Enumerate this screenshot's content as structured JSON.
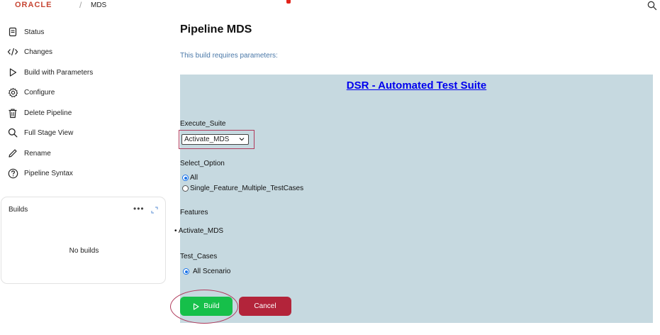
{
  "header": {
    "logo": "ORACLE",
    "separator": "/",
    "breadcrumb": "MDS"
  },
  "sidebar": {
    "items": [
      {
        "label": "Status",
        "icon": "document-icon"
      },
      {
        "label": "Changes",
        "icon": "code-icon"
      },
      {
        "label": "Build with Parameters",
        "icon": "play-icon"
      },
      {
        "label": "Configure",
        "icon": "gear-icon"
      },
      {
        "label": "Delete Pipeline",
        "icon": "trash-icon"
      },
      {
        "label": "Full Stage View",
        "icon": "search-icon"
      },
      {
        "label": "Rename",
        "icon": "pencil-icon"
      },
      {
        "label": "Pipeline Syntax",
        "icon": "help-icon"
      }
    ],
    "builds": {
      "title": "Builds",
      "more": "•••",
      "empty": "No builds"
    }
  },
  "main": {
    "title": "Pipeline MDS",
    "subtitle": "This build requires parameters:",
    "suite_title": "DSR - Automated Test Suite",
    "execute_suite": {
      "label": "Execute_Suite",
      "value": "Activate_MDS"
    },
    "select_option": {
      "label": "Select_Option",
      "options": [
        {
          "label": "All",
          "checked": true
        },
        {
          "label": "Single_Feature_Multiple_TestCases",
          "checked": false
        }
      ]
    },
    "features": {
      "label": "Features",
      "items": [
        "Activate_MDS"
      ]
    },
    "test_cases": {
      "label": "Test_Cases",
      "option": "All Scenario"
    },
    "build_button": "Build",
    "cancel_button": "Cancel"
  },
  "colors": {
    "oracle_red": "#c74634",
    "panel_bg": "#c6d9e0",
    "link_blue": "#0000ee",
    "build_green": "#16c04a",
    "cancel_red": "#b3243a",
    "highlight": "#b03a5b"
  }
}
